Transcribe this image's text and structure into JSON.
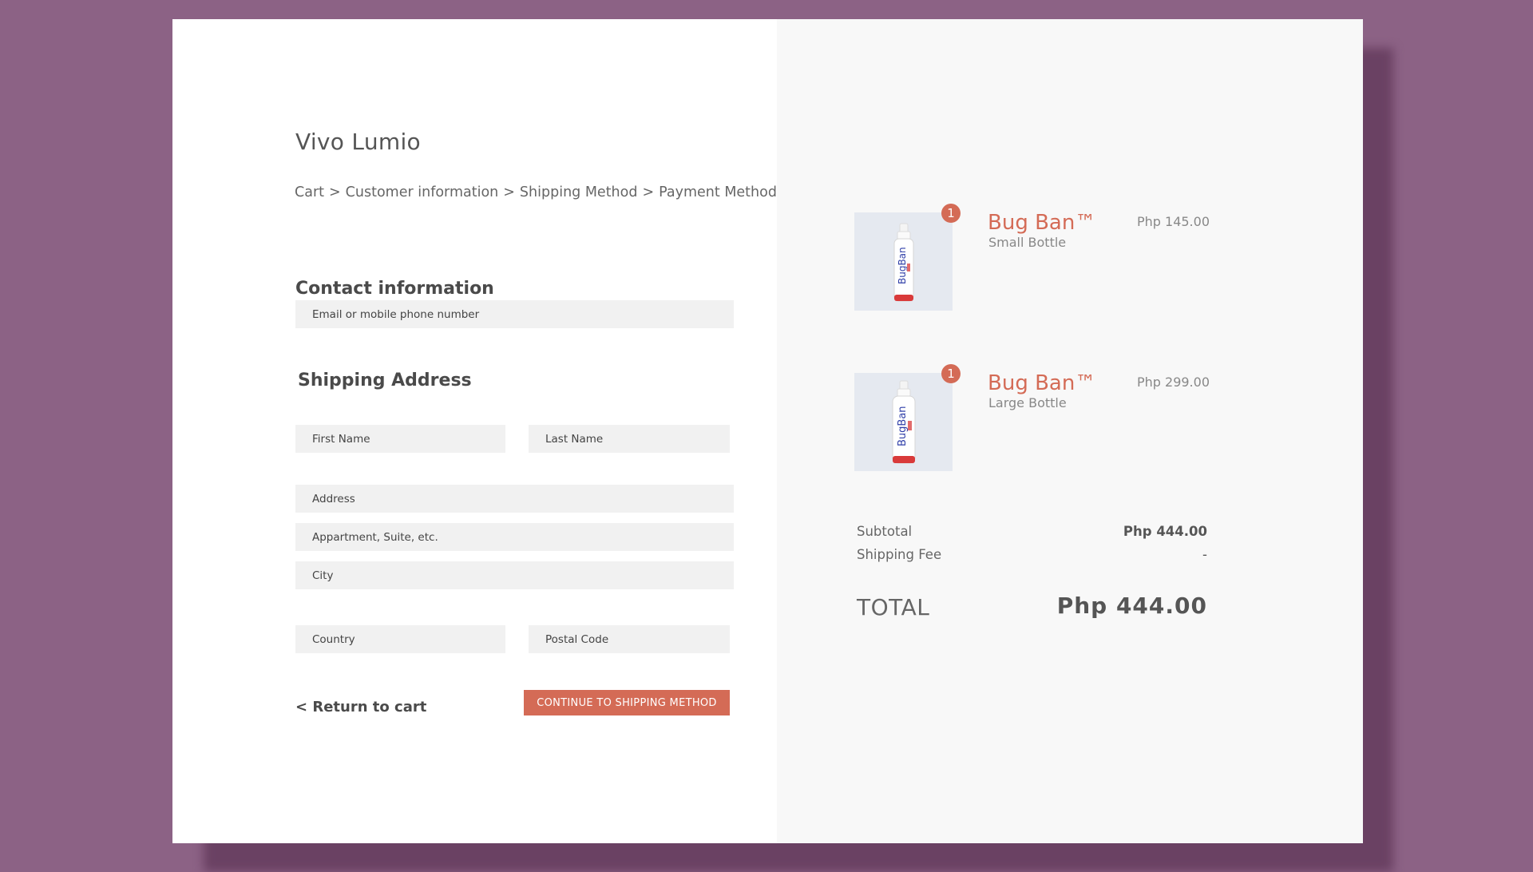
{
  "store": {
    "name": "Vivo Lumio"
  },
  "breadcrumb": {
    "items": [
      "Cart",
      "Customer information",
      "Shipping Method",
      "Payment Method"
    ],
    "separator": ">"
  },
  "contact": {
    "heading": "Contact information",
    "email_placeholder": "Email or mobile phone number"
  },
  "shipping": {
    "heading": "Shipping Address",
    "first_name_placeholder": "First Name",
    "last_name_placeholder": "Last Name",
    "address_placeholder": "Address",
    "apartment_placeholder": "Appartment, Suite, etc.",
    "city_placeholder": "City",
    "country_placeholder": "Country",
    "postal_placeholder": "Postal Code"
  },
  "actions": {
    "return_label": "< Return to cart",
    "continue_label": "CONTINUE TO SHIPPING METHOD"
  },
  "cart": {
    "items": [
      {
        "qty": "1",
        "name": "Bug Ban™",
        "variant": "Small Bottle",
        "price": "Php 145.00",
        "image": "bug-ban-small-bottle"
      },
      {
        "qty": "1",
        "name": "Bug Ban™",
        "variant": "Large Bottle",
        "price": "Php 299.00",
        "image": "bug-ban-large-bottle"
      }
    ],
    "subtotal_label": "Subtotal",
    "subtotal_value": "Php 444.00",
    "shipping_label": "Shipping Fee",
    "shipping_value": "-",
    "total_label": "TOTAL",
    "total_value": "Php 444.00"
  },
  "colors": {
    "background": "#8c6285",
    "accent": "#d46b56",
    "field": "#f1f1f1",
    "summary_panel": "#f8f8f8"
  }
}
